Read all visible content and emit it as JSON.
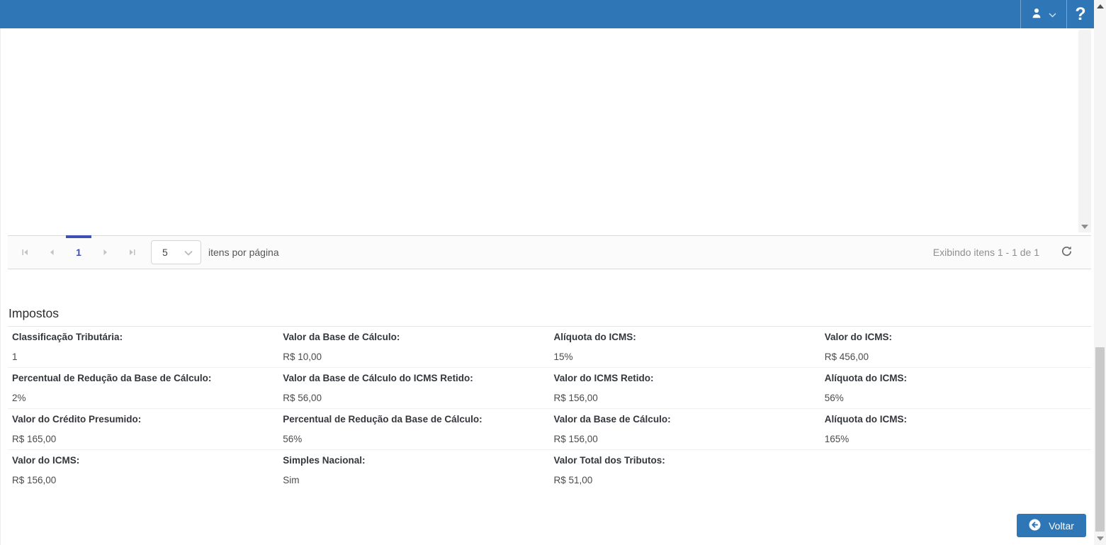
{
  "header": {
    "help_label": "?"
  },
  "pagination": {
    "current_page": "1",
    "page_size": "5",
    "items_per_page_label": "itens por página",
    "status_text": "Exibindo itens 1 - 1 de 1"
  },
  "impostos": {
    "title": "Impostos",
    "fields": [
      {
        "label": "Classificação Tributária:",
        "value": "1"
      },
      {
        "label": "Valor da Base de Cálculo:",
        "value": "R$ 10,00"
      },
      {
        "label": "Alíquota do ICMS:",
        "value": "15%"
      },
      {
        "label": "Valor do ICMS:",
        "value": "R$ 456,00"
      },
      {
        "label": "Percentual de Redução da Base de Cálculo:",
        "value": "2%"
      },
      {
        "label": "Valor da Base de Cálculo do ICMS Retido:",
        "value": "R$ 56,00"
      },
      {
        "label": "Valor do ICMS Retido:",
        "value": "R$ 156,00"
      },
      {
        "label": "Alíquota do ICMS:",
        "value": "56%"
      },
      {
        "label": "Valor do Crédito Presumido:",
        "value": "R$ 165,00"
      },
      {
        "label": "Percentual de Redução da Base de Cálculo:",
        "value": "56%"
      },
      {
        "label": "Valor da Base de Cálculo:",
        "value": "R$ 156,00"
      },
      {
        "label": "Alíquota do ICMS:",
        "value": "165%"
      },
      {
        "label": "Valor do ICMS:",
        "value": "R$ 156,00"
      },
      {
        "label": "Simples Nacional:",
        "value": "Sim"
      },
      {
        "label": "Valor Total dos Tributos:",
        "value": "R$ 51,00"
      }
    ]
  },
  "footer": {
    "back_label": "Voltar"
  },
  "colors": {
    "header_blue": "#2e76b5",
    "accent_indigo": "#3f51b5",
    "button_blue": "#2e76b5"
  }
}
